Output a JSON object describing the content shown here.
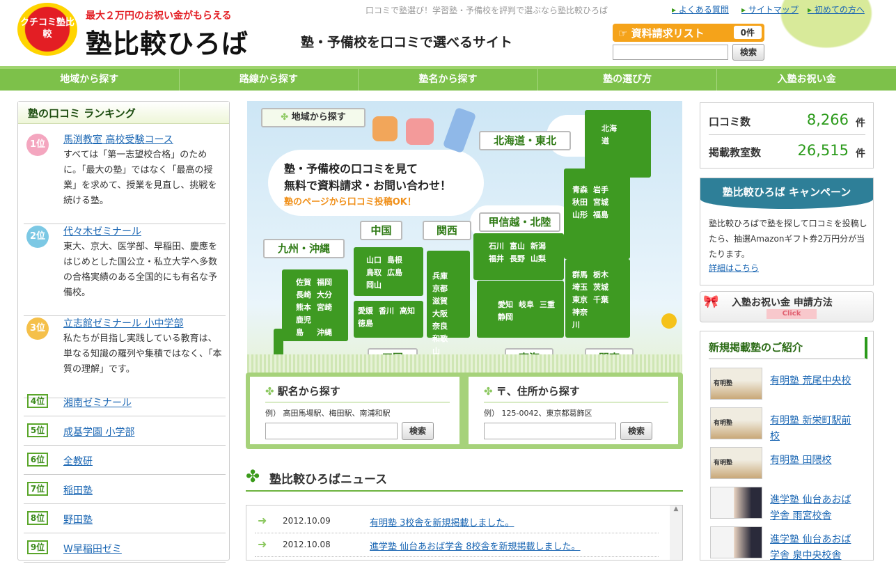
{
  "header": {
    "badge": "クチコミ塾比較",
    "tagline": "最大２万円のお祝い金がもらえる",
    "site_name": "塾比較ひろば",
    "subtitle": "塾・予備校を口コミで選べるサイト",
    "description": "口コミで塾選び！学習塾・予備校を評判で選ぶなら塾比較ひろば",
    "links": [
      "よくある質問",
      "サイトマップ",
      "初めての方へ"
    ],
    "request_list": "資料請求リスト",
    "request_count": "0件",
    "search_button": "検索"
  },
  "nav": [
    "地域から探す",
    "路線から探す",
    "塾名から探す",
    "塾の選び方",
    "入塾お祝い金"
  ],
  "ranking": {
    "title": "塾の口コミ ランキング",
    "top": [
      {
        "rank": "1位",
        "name": "馬渕教室 高校受験コース",
        "desc": "すべては「第一志望校合格」のために。「最大の塾」ではなく「最高の授業」を求めて、授業を見直し、挑戦を続ける塾。",
        "color": "#f4a6bf"
      },
      {
        "rank": "2位",
        "name": "代々木ゼミナール",
        "desc": "東大、京大、医学部、早稲田、慶應をはじめとした国公立・私立大学へ多数の合格実績のある全国的にも有名な予備校。",
        "color": "#7cc8e4"
      },
      {
        "rank": "3位",
        "name": "立志館ゼミナール 小中学部",
        "desc": "私たちが目指し実践している教育は、単なる知識の羅列や集積ではなく、「本質の理解」です。",
        "color": "#f5c04a"
      }
    ],
    "rest": [
      {
        "rank": "4位",
        "name": "湘南ゼミナール"
      },
      {
        "rank": "5位",
        "name": "成基学園 小学部"
      },
      {
        "rank": "6位",
        "name": "全教研"
      },
      {
        "rank": "7位",
        "name": "稲田塾"
      },
      {
        "rank": "8位",
        "name": "野田塾"
      },
      {
        "rank": "9位",
        "name": "W早稲田ゼミ"
      }
    ]
  },
  "map": {
    "title": "地域から探す",
    "cloud_line1": "塾・予備校の口コミを見て",
    "cloud_line2": "無料で資料請求・お問い合わせ！",
    "cloud_line3": "塾のページから口コミ投稿OK！",
    "regions": {
      "hokkaido_tohoku": "北海道・東北",
      "koshinetsu": "甲信越・北陸",
      "chugoku": "中国",
      "kansai": "関西",
      "kyushu": "九州・沖縄",
      "shikoku": "四国",
      "tokai": "東海",
      "kanto": "関東"
    },
    "prefs": {
      "hokkaido": [
        "北海道"
      ],
      "tohoku": [
        "青森",
        "岩手",
        "秋田",
        "宮城",
        "山形",
        "福島"
      ],
      "koshinetsu": [
        "石川",
        "富山",
        "新潟",
        "福井",
        "長野",
        "山梨"
      ],
      "kanto": [
        "群馬",
        "栃木",
        "埼玉",
        "茨城",
        "東京",
        "千葉",
        "神奈川"
      ],
      "tokai": [
        "愛知",
        "岐阜",
        "三重",
        "静岡"
      ],
      "kansai": [
        "兵庫",
        "京都",
        "滋賀",
        "大阪",
        "奈良",
        "和歌山"
      ],
      "chugoku": [
        "山口",
        "島根",
        "鳥取",
        "広島",
        "岡山"
      ],
      "shikoku": [
        "愛媛",
        "香川",
        "高知",
        "徳島"
      ],
      "kyushu": [
        "佐賀",
        "福岡",
        "長崎",
        "大分",
        "熊本",
        "宮崎",
        "鹿児島",
        "沖縄"
      ]
    }
  },
  "search": {
    "station": {
      "title": "駅名から探す",
      "example": "例） 高田馬場駅、梅田駅、南浦和駅",
      "button": "検索"
    },
    "address": {
      "title": "〒、住所から探す",
      "example": "例） 125-0042、東京都葛飾区",
      "button": "検索"
    }
  },
  "news": {
    "title": "塾比較ひろばニュース",
    "items": [
      {
        "date": "2012.10.09",
        "text": "有明塾 3校舎を新規掲載しました。"
      },
      {
        "date": "2012.10.08",
        "text": "進学塾 仙台あおば学舎 8校舎を新規掲載しました。"
      }
    ]
  },
  "stats": {
    "reviews_label": "口コミ数",
    "reviews": "8,266",
    "schools_label": "掲載教室数",
    "schools": "26,515",
    "unit": "件"
  },
  "campaign": {
    "title": "塾比較ひろば キャンペーン",
    "text": "塾比較ひろばで塾を探して口コミを投稿したら、抽選Amazonギフト券2万円分が当たります。",
    "link": "詳細はこちら"
  },
  "oiwai": {
    "title": "入塾お祝い金 申請方法",
    "click": "Click"
  },
  "new_schools": {
    "title": "新規掲載塾のご紹介",
    "items": [
      {
        "name": "有明塾 荒尾中央校",
        "thumb": "有明塾"
      },
      {
        "name": "有明塾 新栄町駅前校",
        "thumb": "有明塾"
      },
      {
        "name": "有明塾 田隈校",
        "thumb": "有明塾"
      },
      {
        "name": "進学塾 仙台あおば学舎 雨宮校舎",
        "thumb": ""
      },
      {
        "name": "進学塾 仙台あおば学舎 泉中央校舎",
        "thumb": ""
      }
    ]
  }
}
